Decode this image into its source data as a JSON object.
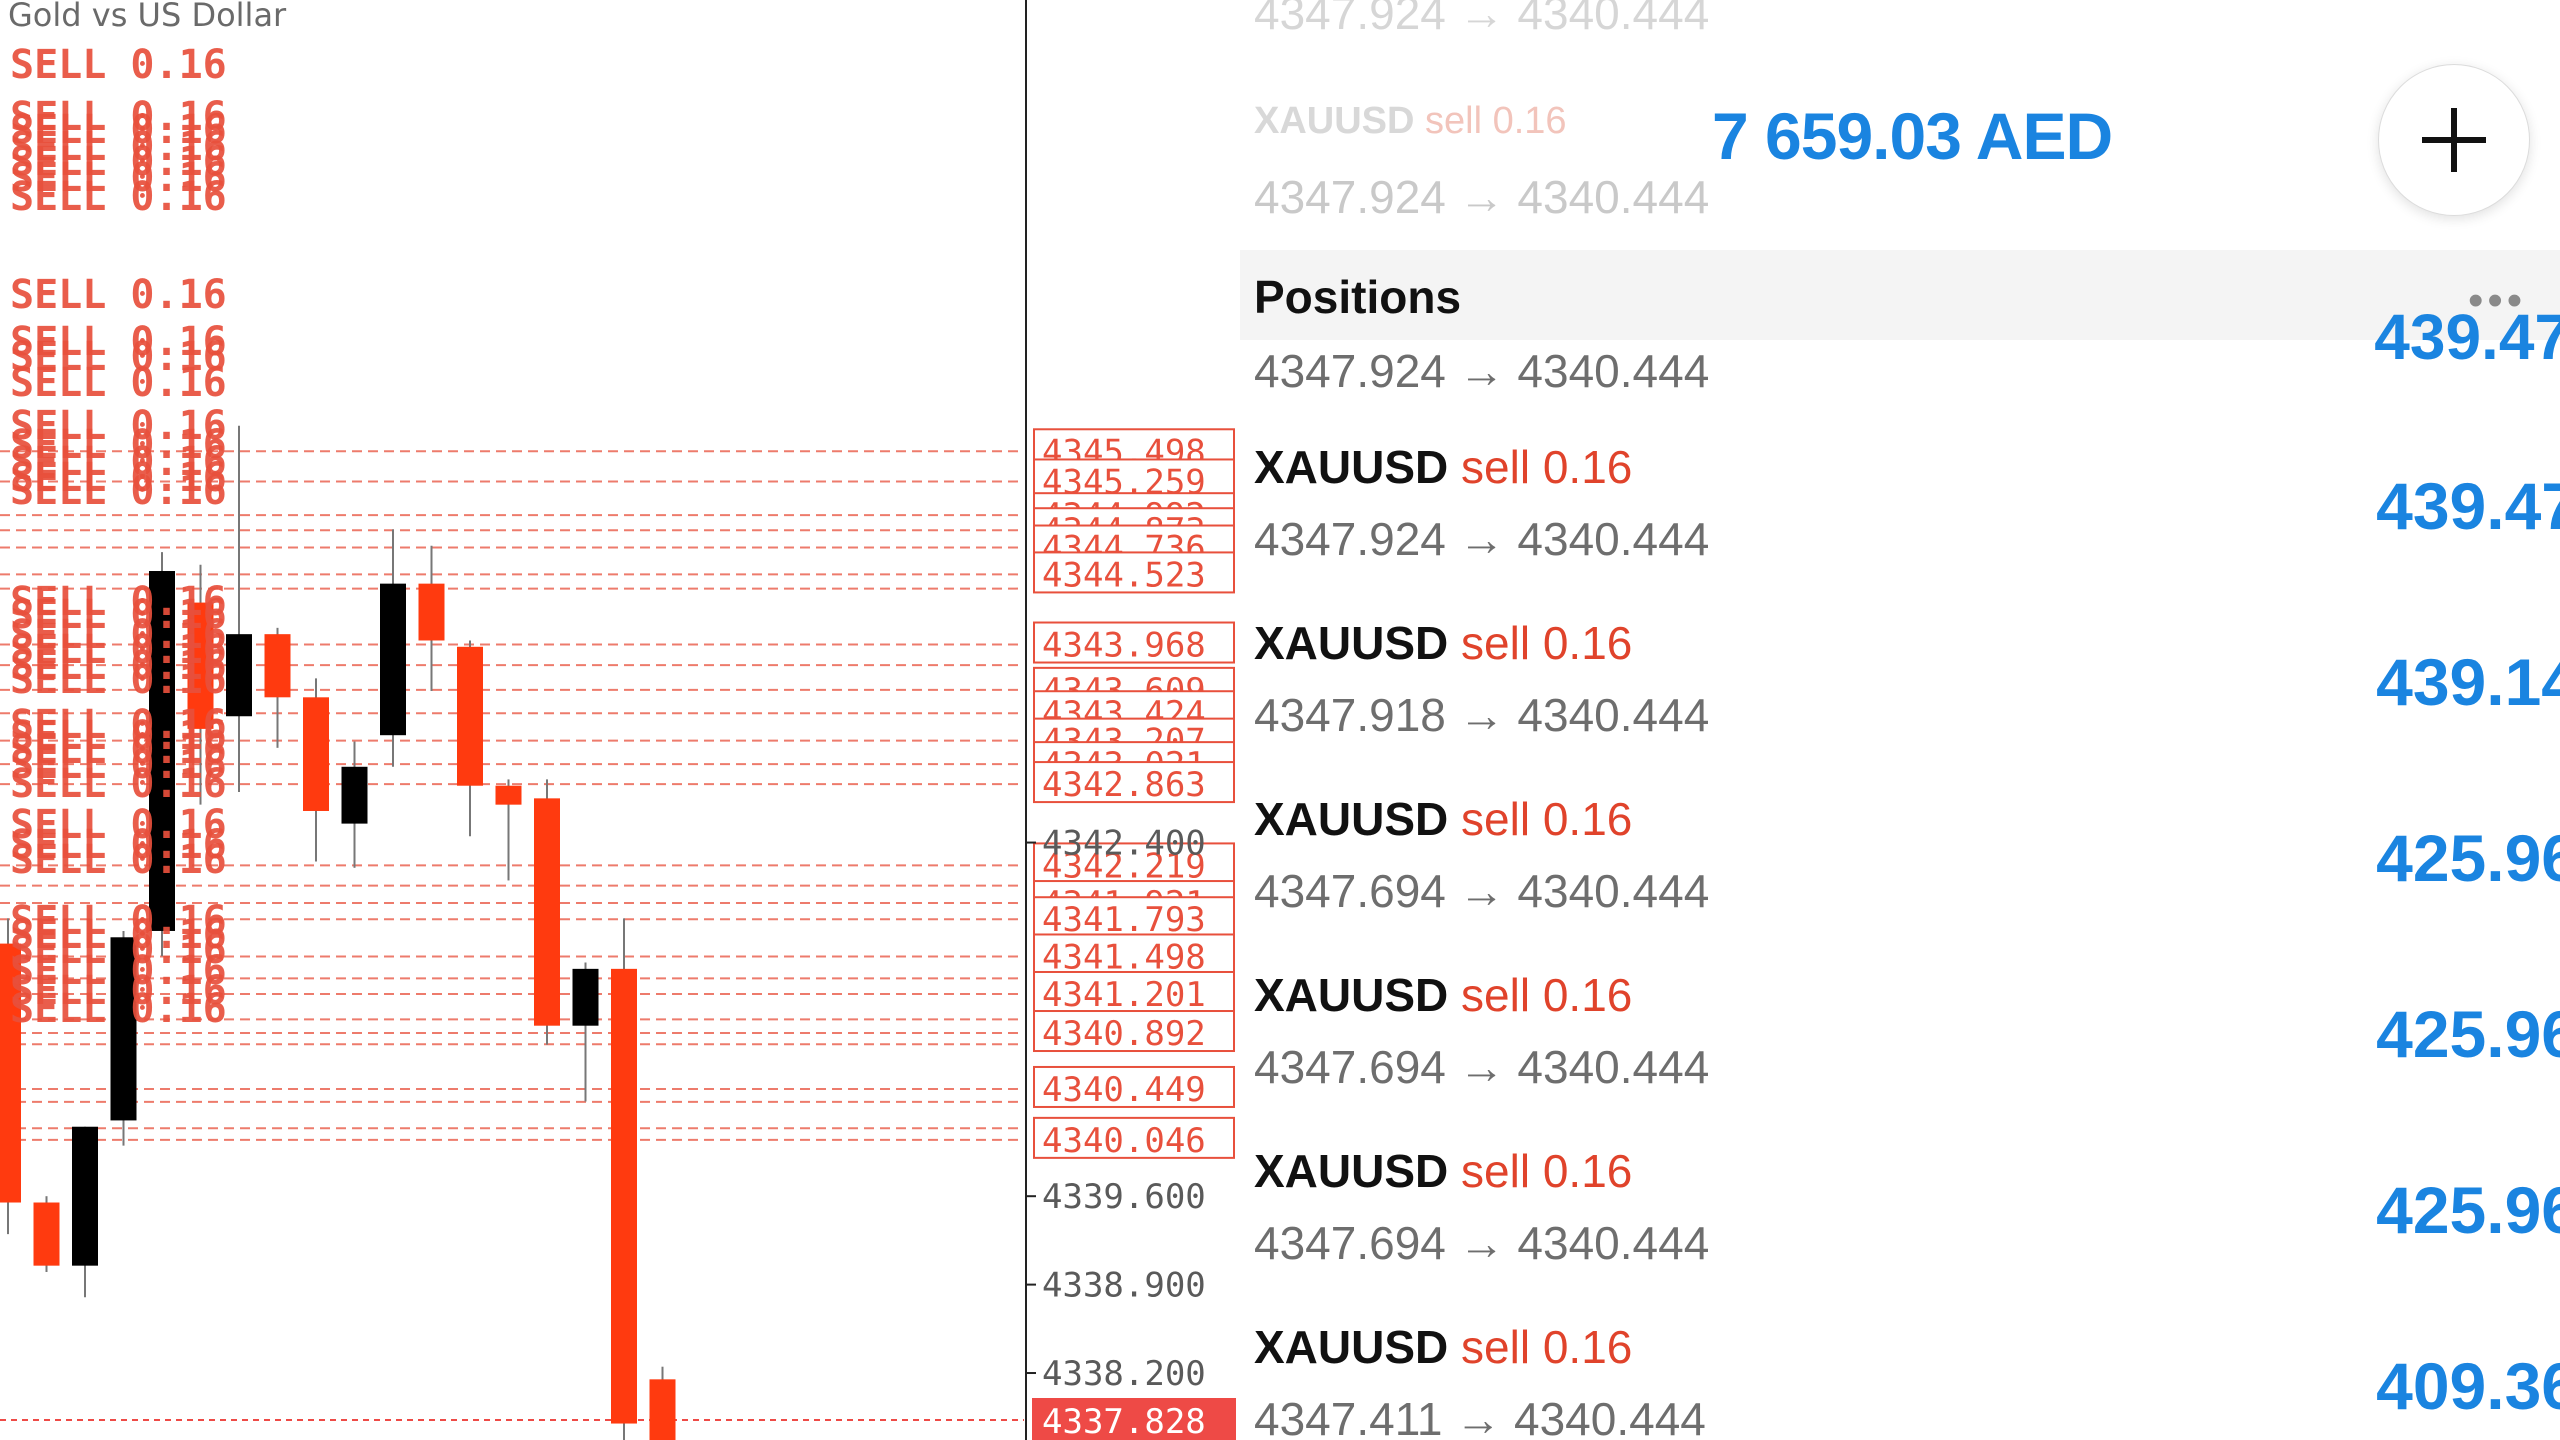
{
  "chart": {
    "title": "Gold vs US Dollar",
    "order_label": "SELL 0.16",
    "order_label_rows": [
      60,
      112,
      125,
      142,
      157,
      173,
      192,
      290,
      337,
      352,
      378,
      421,
      440,
      457,
      473,
      486,
      597,
      610,
      630,
      645,
      661,
      675,
      720,
      731,
      745,
      760,
      779,
      820,
      840,
      855,
      916,
      930,
      945,
      966,
      986,
      1004
    ],
    "order_lines": [
      4345.498,
      4345.259,
      4344.992,
      4344.873,
      4344.736,
      4344.523,
      4344.411,
      4343.968,
      4343.805,
      4343.609,
      4343.424,
      4343.207,
      4343.021,
      4342.863,
      4342.219,
      4342.059,
      4341.921,
      4341.793,
      4341.498,
      4341.325,
      4341.201,
      4341.0,
      4340.892,
      4340.803,
      4340.449,
      4340.347,
      4340.138,
      4340.046
    ],
    "axis_prices": [
      "4345.498",
      "4345.259",
      "4344.992",
      "4344.873",
      "4344.736",
      "4344.523",
      "4343.968",
      "4343.609",
      "4343.424",
      "4343.207",
      "4343.021",
      "4342.863",
      "4342.400",
      "4342.219",
      "4341.921",
      "4341.793",
      "4341.498",
      "4341.201",
      "4340.892",
      "4340.449",
      "4340.046",
      "4339.600",
      "4338.900",
      "4338.200",
      "4337.828"
    ],
    "boxed_prices": [
      "4345.498",
      "4345.259",
      "4344.992",
      "4344.873",
      "4344.736",
      "4344.523",
      "4343.968",
      "4343.609",
      "4343.424",
      "4343.207",
      "4343.021",
      "4342.863",
      "4342.219",
      "4341.921",
      "4341.793",
      "4341.498",
      "4341.201",
      "4340.892",
      "4340.449",
      "4340.046"
    ],
    "grid_prices": [
      "4342.400",
      "4339.600",
      "4338.900",
      "4338.200"
    ],
    "current_price": "4337.828",
    "candles": [
      {
        "o": 4341.6,
        "h": 4341.8,
        "l": 4339.3,
        "c": 4339.55
      },
      {
        "o": 4339.55,
        "h": 4339.6,
        "l": 4339.0,
        "c": 4339.05
      },
      {
        "o": 4339.05,
        "h": 4340.15,
        "l": 4338.8,
        "c": 4340.15
      },
      {
        "o": 4340.2,
        "h": 4341.7,
        "l": 4340.0,
        "c": 4341.65
      },
      {
        "o": 4341.7,
        "h": 4344.7,
        "l": 4341.5,
        "c": 4344.55
      },
      {
        "o": 4344.3,
        "h": 4344.6,
        "l": 4342.7,
        "c": 4343.3
      },
      {
        "o": 4343.4,
        "h": 4345.7,
        "l": 4342.8,
        "c": 4344.05
      },
      {
        "o": 4344.05,
        "h": 4344.1,
        "l": 4343.15,
        "c": 4343.55
      },
      {
        "o": 4343.55,
        "h": 4343.7,
        "l": 4342.25,
        "c": 4342.65
      },
      {
        "o": 4342.55,
        "h": 4343.2,
        "l": 4342.2,
        "c": 4343.0
      },
      {
        "o": 4343.25,
        "h": 4344.88,
        "l": 4343.0,
        "c": 4344.45
      },
      {
        "o": 4344.45,
        "h": 4344.75,
        "l": 4343.6,
        "c": 4344.0
      },
      {
        "o": 4343.95,
        "h": 4344.0,
        "l": 4342.45,
        "c": 4342.85
      },
      {
        "o": 4342.85,
        "h": 4342.9,
        "l": 4342.1,
        "c": 4342.7
      },
      {
        "o": 4342.75,
        "h": 4342.9,
        "l": 4340.8,
        "c": 4340.95
      },
      {
        "o": 4340.95,
        "h": 4341.45,
        "l": 4340.35,
        "c": 4341.4
      },
      {
        "o": 4341.4,
        "h": 4341.8,
        "l": 4337.5,
        "c": 4337.8
      },
      {
        "o": 4338.15,
        "h": 4338.25,
        "l": 4337.4,
        "c": 4337.6
      }
    ],
    "colors": {
      "bull": "#000000",
      "bear": "#ff3a0f",
      "order": "#e8503c",
      "axis_text": "#5a5a5a",
      "current_bg": "#ee4a46"
    }
  },
  "top": {
    "ghost_prices": "4347.924 → 4340.444",
    "ghost_top_prices": "4347.924 → 4340.444",
    "ghost_symbol": "XAUUSD",
    "ghost_side": "sell 0.16",
    "balance": "7 659.03 AED",
    "add_icon": "plus-icon"
  },
  "positions": {
    "title": "Positions",
    "more_icon": "•••",
    "partial_prices": "4347.924 → 4340.444",
    "partial_profit": "439.47",
    "rows": [
      {
        "symbol": "XAUUSD",
        "side": "sell",
        "volume": "0.16",
        "prices": "4347.924 → 4340.444",
        "profit": "439.47"
      },
      {
        "symbol": "XAUUSD",
        "side": "sell",
        "volume": "0.16",
        "prices": "4347.918 → 4340.444",
        "profit": "439.14"
      },
      {
        "symbol": "XAUUSD",
        "side": "sell",
        "volume": "0.16",
        "prices": "4347.694 → 4340.444",
        "profit": "425.96"
      },
      {
        "symbol": "XAUUSD",
        "side": "sell",
        "volume": "0.16",
        "prices": "4347.694 → 4340.444",
        "profit": "425.96"
      },
      {
        "symbol": "XAUUSD",
        "side": "sell",
        "volume": "0.16",
        "prices": "4347.694 → 4340.444",
        "profit": "425.96"
      },
      {
        "symbol": "XAUUSD",
        "side": "sell",
        "volume": "0.16",
        "prices": "4347.411 → 4340.444",
        "profit": "409.36"
      }
    ]
  }
}
